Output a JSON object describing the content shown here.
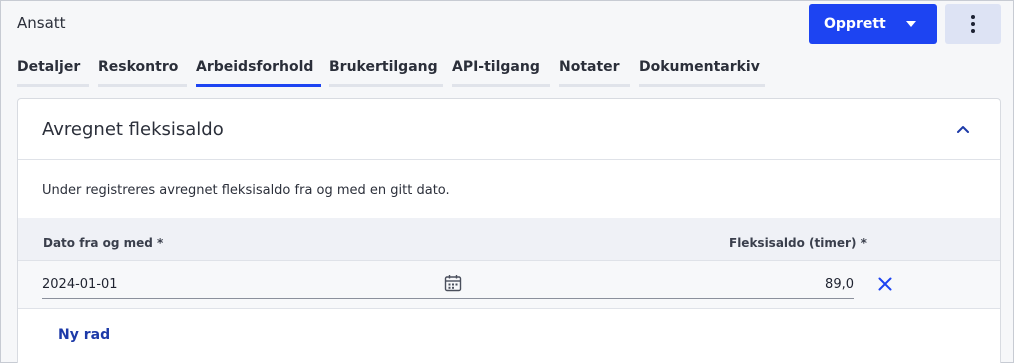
{
  "header": {
    "title": "Ansatt",
    "create_label": "Opprett",
    "more_icon": "more-vertical-icon"
  },
  "tabs": [
    {
      "label": "Detaljer",
      "active": false
    },
    {
      "label": "Reskontro",
      "active": false
    },
    {
      "label": "Arbeidsforhold",
      "active": true
    },
    {
      "label": "Brukertilgang",
      "active": false
    },
    {
      "label": "API-tilgang",
      "active": false
    },
    {
      "label": "Notater",
      "active": false
    },
    {
      "label": "Dokumentarkiv",
      "active": false
    }
  ],
  "panel": {
    "title": "Avregnet fleksisaldo",
    "collapse_icon": "chevron-up-icon",
    "description": "Under registreres avregnet fleksisaldo fra og med en gitt dato.",
    "columns": {
      "date": "Dato fra og med *",
      "balance": "Fleksisaldo (timer) *"
    },
    "rows": [
      {
        "date": "2024-01-01",
        "balance": "89,0"
      }
    ],
    "add_row_label": "Ny rad"
  },
  "colors": {
    "accent": "#1d44f2",
    "link": "#1d3aa8"
  }
}
